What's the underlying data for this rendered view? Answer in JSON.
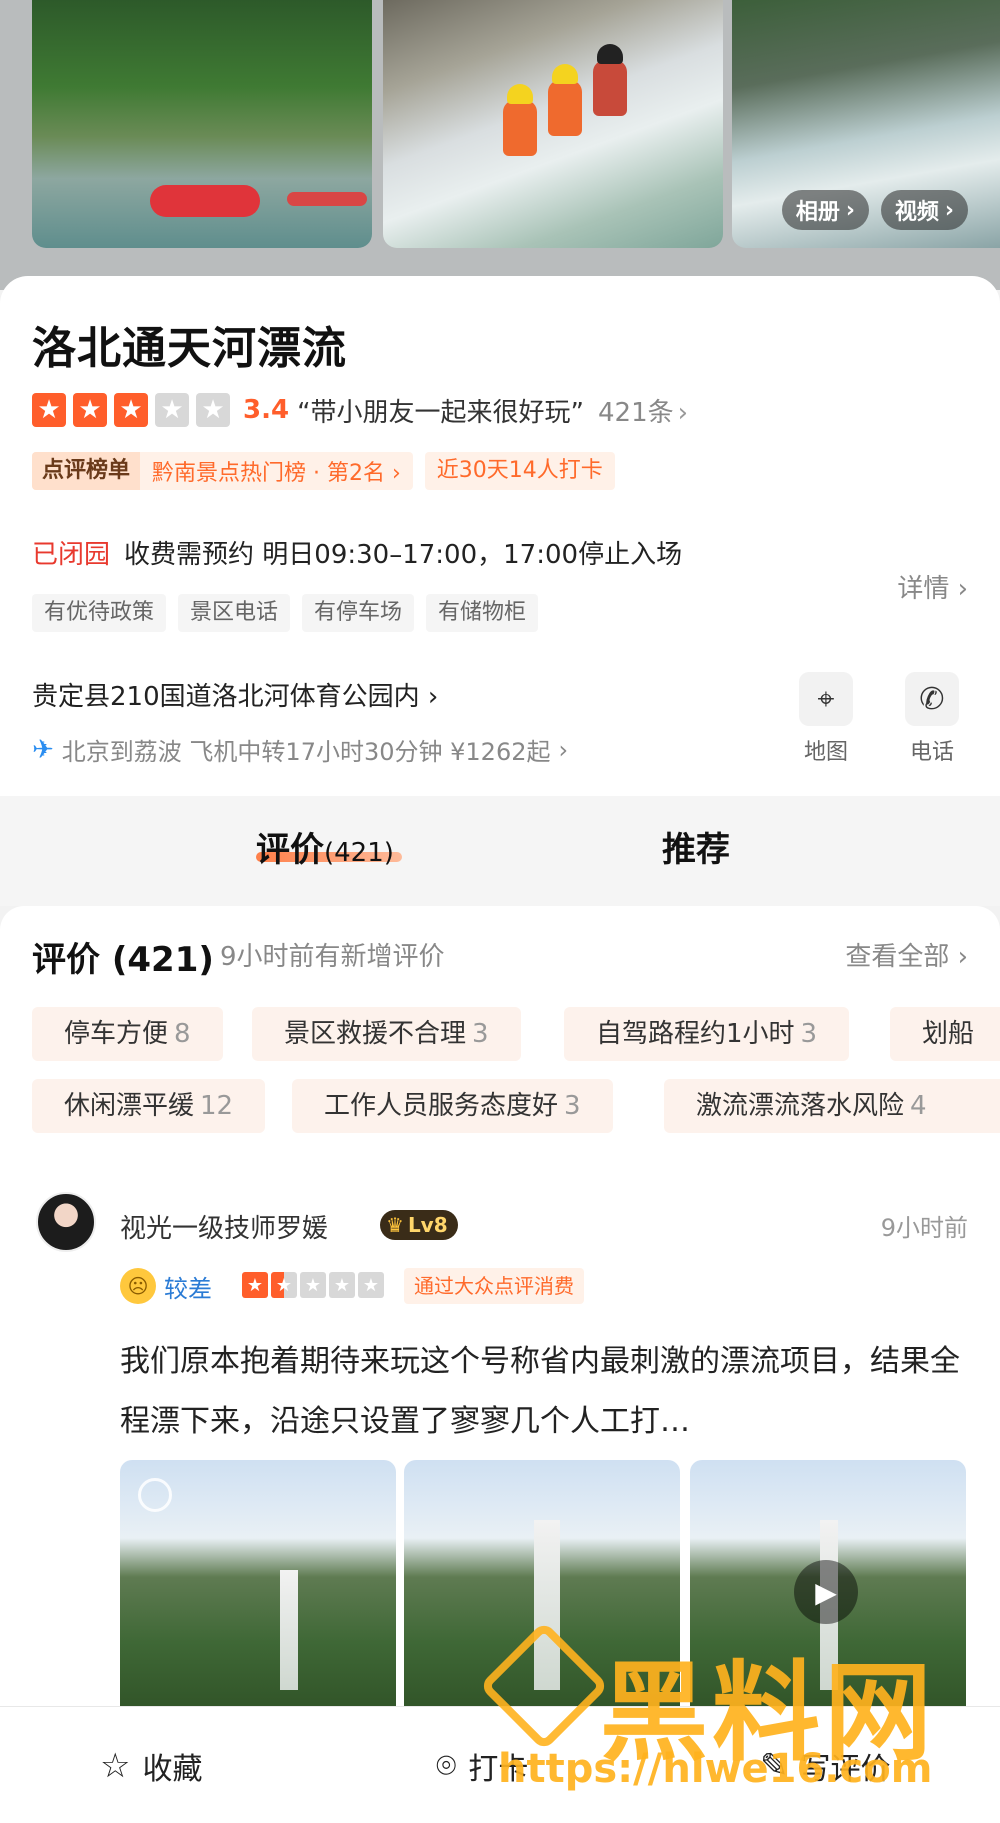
{
  "hero": {
    "album_label": "相册",
    "video_label": "视频"
  },
  "poi": {
    "title": "洛北通天河漂流",
    "stars_filled": 3,
    "stars_total": 5,
    "score": "3.4",
    "quote": "“带小朋友一起来很好玩”",
    "review_count": "421条",
    "rank_tag": "点评榜单",
    "rank_text": "黔南景点热门榜 · 第2名",
    "checkin": "近30天14人打卡",
    "status": "已闭园",
    "hours": "收费需预约 明日09:30–17:00，17:00停止入场",
    "detail": "详情",
    "facilities": [
      "有优待政策",
      "景区电话",
      "有停车场",
      "有储物柜"
    ],
    "address": "贵定县210国道洛北河体育公园内",
    "transport": "北京到荔波 飞机中转17小时30分钟 ¥1262起",
    "map_label": "地图",
    "phone_label": "电话"
  },
  "tabs": {
    "review": "评价",
    "review_count": "(421)",
    "recommend": "推荐"
  },
  "reviews": {
    "title": "评价 (421)",
    "new_hint": "9小时前有新增评价",
    "view_all": "查看全部",
    "tags": [
      {
        "label": "停车方便",
        "count": "8"
      },
      {
        "label": "景区救援不合理",
        "count": "3"
      },
      {
        "label": "自驾路程约1小时",
        "count": "3"
      },
      {
        "label": "划船",
        "count": ""
      },
      {
        "label": "休闲漂平缓",
        "count": "12"
      },
      {
        "label": "工作人员服务态度好",
        "count": "3"
      },
      {
        "label": "激流漂流落水风险",
        "count": "4"
      }
    ],
    "item": {
      "user": "视光一级技师罗媛",
      "level": "Lv8",
      "time": "9小时前",
      "mood": "较差",
      "stars": 1.5,
      "via": "通过大众点评消费",
      "text": "我们原本抱着期待来玩这个号称省内最刺激的漂流项目，结果全程漂下来，沿途只设置了寥寥几个人工打…"
    }
  },
  "bottom": {
    "favorite": "收藏",
    "checkin": "打卡",
    "write_review": "写评价"
  },
  "watermark": {
    "brand": "黑料网",
    "url": "https://hlwe16.com"
  },
  "colors": {
    "accent": "#ff5e2b",
    "closed": "#e8392e",
    "watermark": "#ffb21e"
  }
}
